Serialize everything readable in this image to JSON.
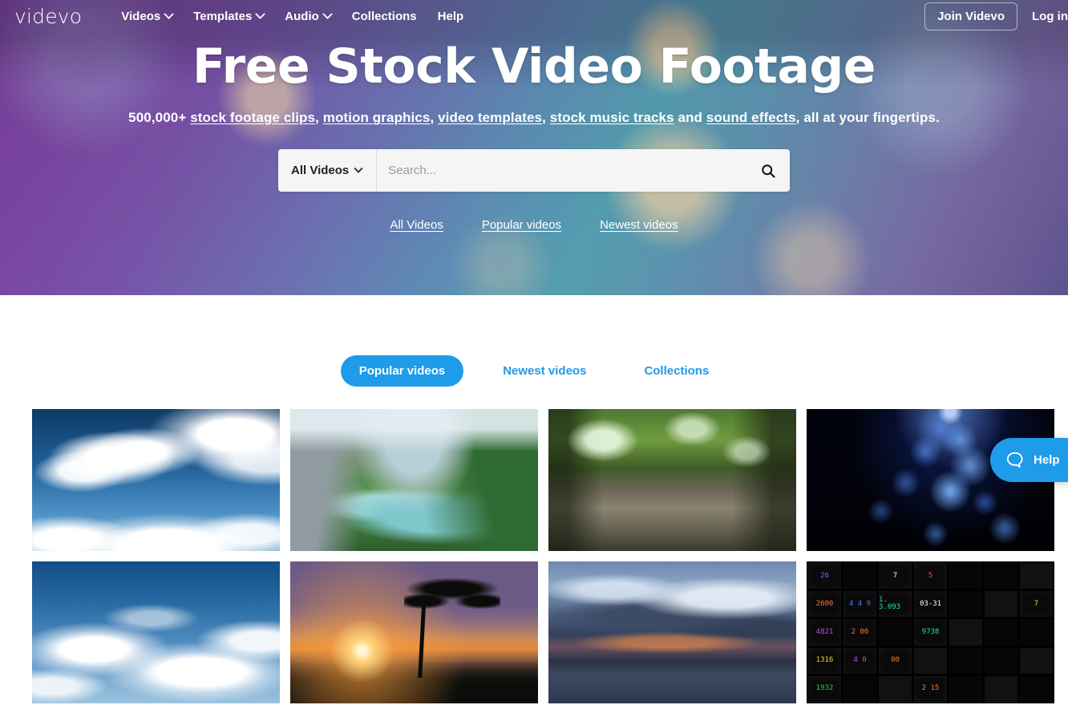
{
  "brand": {
    "logo_text": "videvo",
    "accent_color": "#1e9be9"
  },
  "navbar": {
    "items": [
      {
        "label": "Videos",
        "has_dropdown": true
      },
      {
        "label": "Templates",
        "has_dropdown": true
      },
      {
        "label": "Audio",
        "has_dropdown": true
      },
      {
        "label": "Collections",
        "has_dropdown": false
      },
      {
        "label": "Help",
        "has_dropdown": false
      }
    ],
    "join_label": "Join Videvo",
    "login_label": "Log in"
  },
  "hero": {
    "title": "Free Stock Video Footage",
    "subtitle": {
      "prefix": "500,000+ ",
      "link1": "stock footage clips",
      "sep1": ", ",
      "link2": "motion graphics",
      "sep2": ", ",
      "link3": "video templates",
      "sep3": ", ",
      "link4": "stock music tracks",
      "sep4": " and ",
      "link5": "sound effects",
      "suffix": ", all at your fingertips."
    },
    "search": {
      "category_label": "All Videos",
      "placeholder": "Search...",
      "value": "",
      "button_icon": "search-icon"
    },
    "quick_links": [
      "All Videos",
      "Popular videos",
      "Newest videos"
    ]
  },
  "tabs": [
    {
      "label": "Popular videos",
      "active": true
    },
    {
      "label": "Newest videos",
      "active": false
    },
    {
      "label": "Collections",
      "active": false
    }
  ],
  "grid": {
    "items": [
      {
        "name": "blue-sky-clouds",
        "art": "art-clouds-a"
      },
      {
        "name": "glacier-valley-river",
        "art": "art-valley"
      },
      {
        "name": "rain-on-ground-forest",
        "art": "art-rain"
      },
      {
        "name": "blue-particles-space",
        "art": "art-particles"
      },
      {
        "name": "clouds-daytime-sky",
        "art": "art-clouds-b"
      },
      {
        "name": "acacia-tree-sunset-birds",
        "art": "art-sunset"
      },
      {
        "name": "dusk-lake-clouds",
        "art": "art-dusk"
      },
      {
        "name": "digital-counter-displays",
        "art": "art-displays"
      }
    ],
    "display_cells": [
      "26",
      "",
      "7",
      "5",
      "",
      "",
      "",
      "2600",
      "4 4 9",
      "1. 3.093",
      "03-31",
      "",
      "",
      "7",
      "4821",
      "2 00",
      "",
      "9738",
      "",
      "",
      "",
      "1316",
      "4 0",
      "00",
      "",
      "",
      "",
      "",
      "1932",
      "",
      "",
      "2 15",
      "",
      "",
      ""
    ]
  },
  "help_widget": {
    "label": "Help",
    "icon": "chat-bubble-icon"
  }
}
